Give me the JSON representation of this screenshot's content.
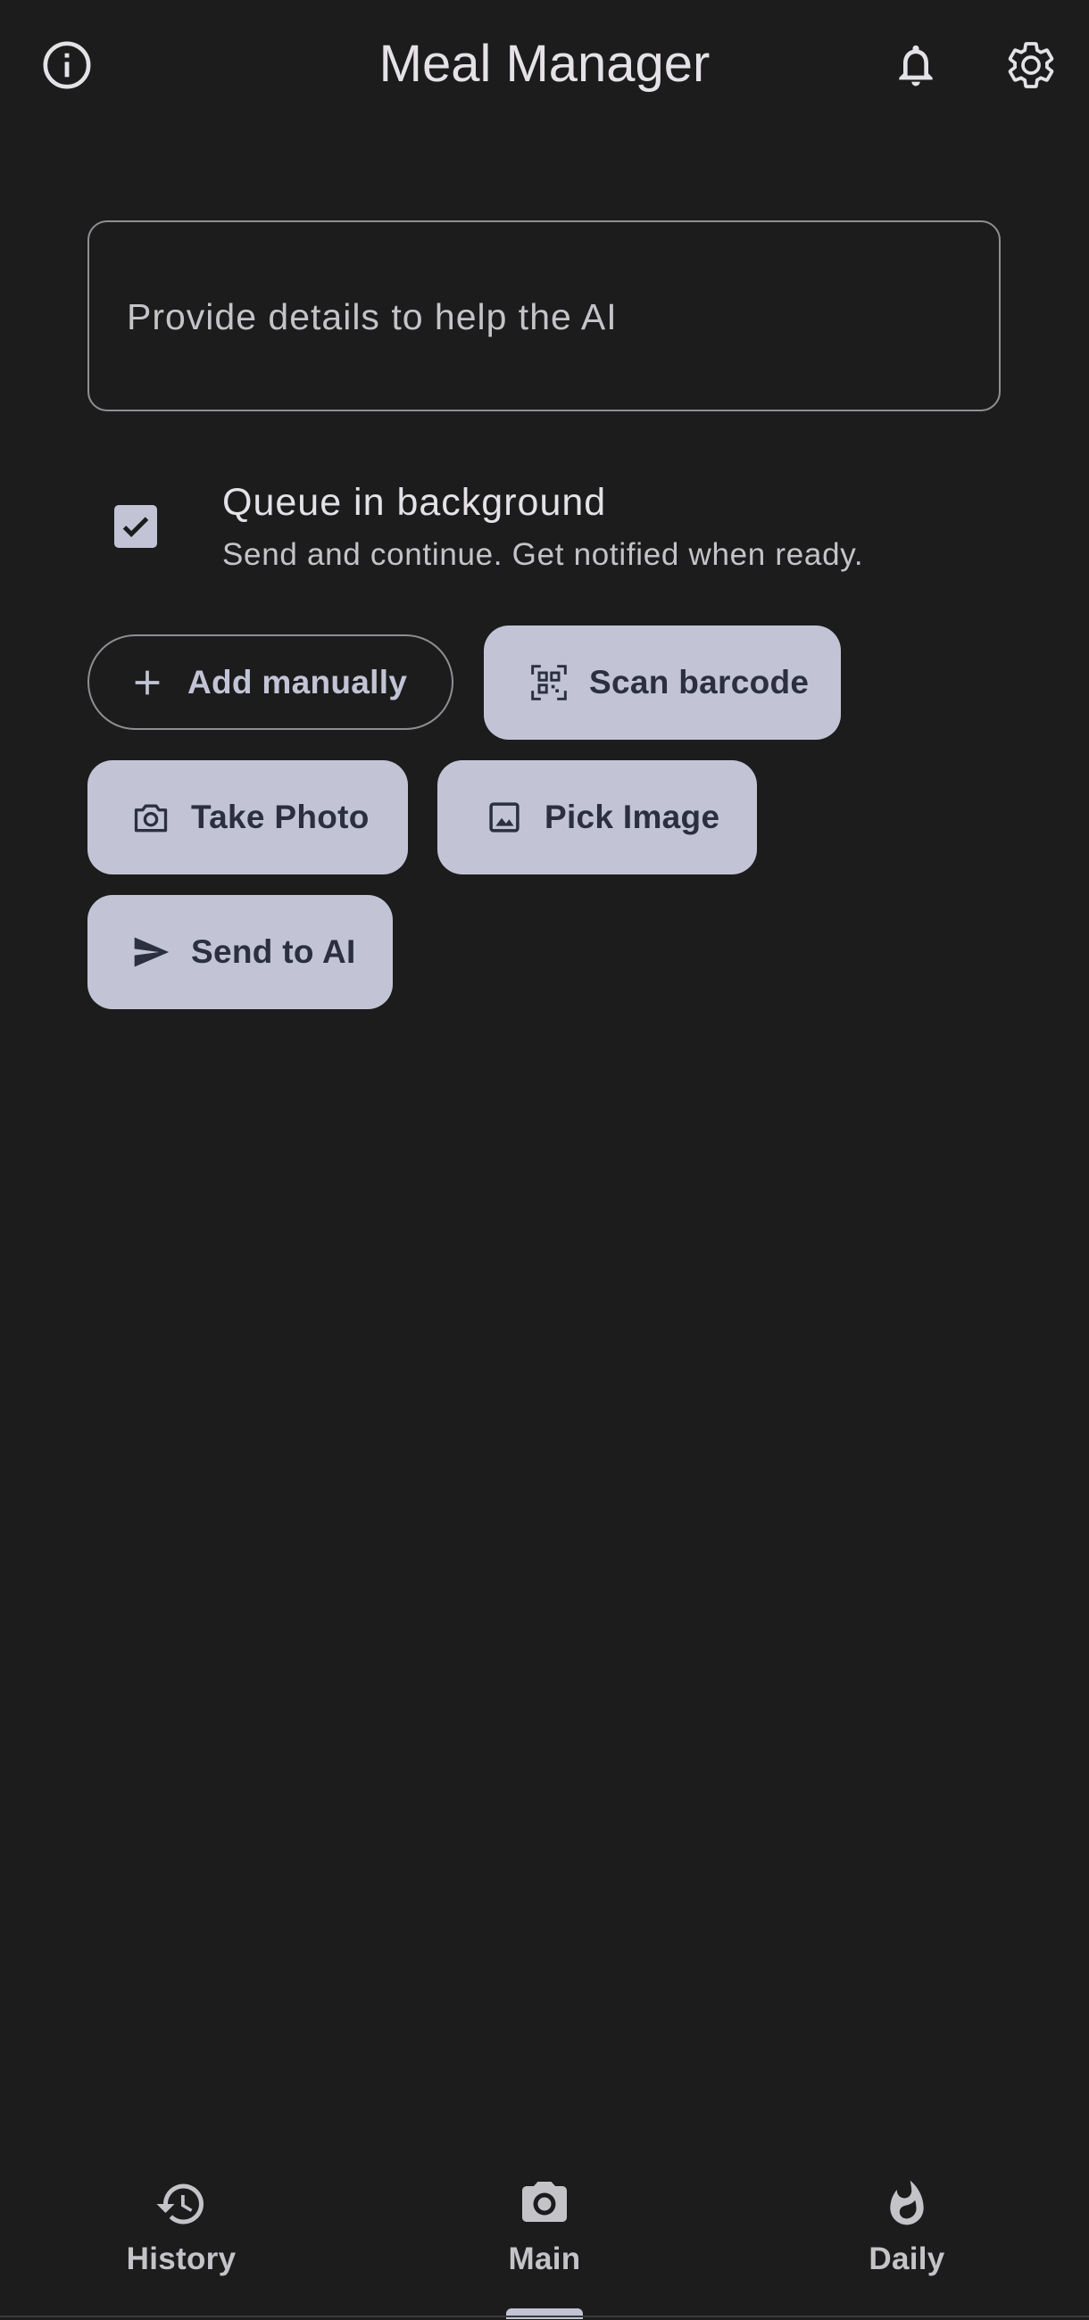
{
  "app_bar": {
    "title": "Meal Manager",
    "icons": {
      "info": "info-icon",
      "notifications": "bell-icon",
      "settings": "gear-icon"
    }
  },
  "details": {
    "placeholder": "Provide details to help the AI",
    "value": ""
  },
  "queue": {
    "checked": true,
    "title": "Queue in background",
    "subtitle": "Send and continue. Get notified when ready."
  },
  "actions": {
    "add_manually": {
      "label": "Add manually",
      "icon": "plus-icon"
    },
    "scan_barcode": {
      "label": "Scan barcode",
      "icon": "qr-scan-icon"
    },
    "take_photo": {
      "label": "Take Photo",
      "icon": "camera-icon"
    },
    "pick_image": {
      "label": "Pick Image",
      "icon": "image-icon"
    },
    "send_to_ai": {
      "label": "Send to AI",
      "icon": "send-icon"
    }
  },
  "bottom_nav": {
    "items": [
      {
        "label": "History",
        "icon": "history-icon"
      },
      {
        "label": "Main",
        "icon": "camera-icon"
      },
      {
        "label": "Daily",
        "icon": "flame-icon"
      }
    ],
    "selected": "Main"
  },
  "colors": {
    "background": "#1c1c1d",
    "on_surface": "#e4e2e6",
    "on_surface_variant": "#c4c3c8",
    "outline": "#8f8f93",
    "secondary_container": "#c2c4d6",
    "on_secondary_container": "#2c2f3e"
  }
}
